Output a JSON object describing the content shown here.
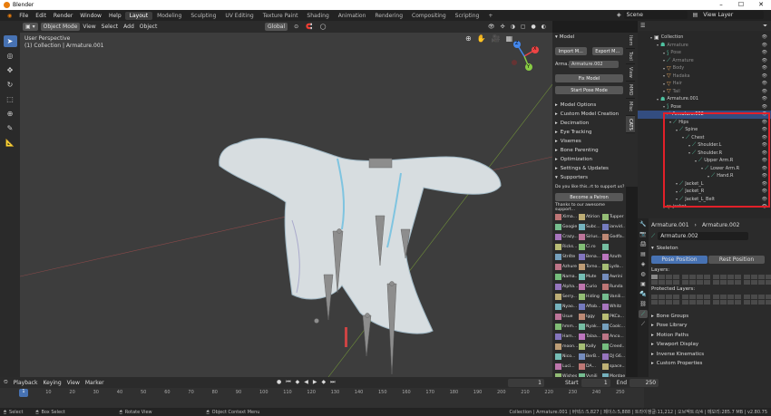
{
  "window": {
    "title": "Blender",
    "controls": [
      "–",
      "☐",
      "✕"
    ]
  },
  "menu": {
    "items": [
      "File",
      "Edit",
      "Render",
      "Window",
      "Help"
    ],
    "workspaces": [
      "Layout",
      "Modeling",
      "Sculpting",
      "UV Editing",
      "Texture Paint",
      "Shading",
      "Animation",
      "Rendering",
      "Compositing",
      "Scripting",
      "+"
    ],
    "scene": "Scene",
    "view_layer": "View Layer"
  },
  "viewport": {
    "mode": "Object Mode",
    "menus": [
      "View",
      "Select",
      "Add",
      "Object"
    ],
    "transform": "Global",
    "info_line1": "User Perspective",
    "info_line2": "(1) Collection | Armature.001",
    "gizmo": {
      "x": "X",
      "y": "Y",
      "z": "Z"
    }
  },
  "npanel": {
    "header": "Model",
    "import": "Import M...",
    "export": "Export M...",
    "armature_label": "Arma...",
    "armature_value": "Armature.002",
    "fix_model": "Fix Model",
    "start_pose": "Start Pose Mode",
    "sections": [
      "Model Options",
      "Custom Model Creation",
      "Decimation",
      "Eye Tracking",
      "Visemes",
      "Bone Parenting",
      "Optimization",
      "Settings & Updates",
      "Supporters"
    ],
    "support_q": "Do you like this..rt to support us?",
    "patron": "Become a Patron",
    "thanks": "Thanks to our awesome support...",
    "supporters": [
      "Xima...",
      "Atirion",
      "Tupper",
      "Googie",
      "Subc...",
      "ianvid...",
      "Crazy...",
      "Sirius...",
      "Godfa...",
      "Ricks...",
      "Ci.ro",
      "",
      "Str4te",
      "Bena...",
      "Azuth",
      "Azhure",
      "Torno...",
      "Lyda...",
      "Nama...",
      "Mute",
      "Awrini",
      "Alpha...",
      "Curio",
      "Runda",
      "Serry...",
      "Hiding",
      "Vanili...",
      "Nyao...",
      "Aftob...",
      "Whitz",
      "Usue",
      "Iggy",
      "PKCa...",
      "hmm...",
      "Nyak...",
      "Coolc...",
      "Ham...",
      "Talaa...",
      "Anco...",
      "moon...",
      "Kally",
      "Creed...",
      "Nico...",
      "BerB...",
      "DJ G6...",
      "Luci...",
      "DA...",
      "space...",
      "Wishes",
      "Vynili",
      "Mordae"
    ],
    "tabs": [
      "Item",
      "Tool",
      "View",
      "MMD",
      "Misc",
      "CATS"
    ]
  },
  "outliner": {
    "rows": [
      {
        "depth": 0,
        "label": "Collection",
        "kind": "collection",
        "dim": false
      },
      {
        "depth": 1,
        "label": "Armature",
        "kind": "armature",
        "dim": true
      },
      {
        "depth": 2,
        "label": "Pose",
        "kind": "pose",
        "dim": true
      },
      {
        "depth": 2,
        "label": "Armature",
        "kind": "bone",
        "dim": true
      },
      {
        "depth": 2,
        "label": "Body",
        "kind": "mesh",
        "dim": true
      },
      {
        "depth": 2,
        "label": "Hadaka",
        "kind": "mesh",
        "dim": true
      },
      {
        "depth": 2,
        "label": "Hair",
        "kind": "mesh",
        "dim": true
      },
      {
        "depth": 2,
        "label": "Tail",
        "kind": "mesh",
        "dim": true
      },
      {
        "depth": 1,
        "label": "Armature.001",
        "kind": "armature",
        "dim": false
      },
      {
        "depth": 2,
        "label": "Pose",
        "kind": "pose",
        "dim": false
      },
      {
        "depth": 2,
        "label": "Armature.002",
        "kind": "bone",
        "dim": false,
        "selected": true
      },
      {
        "depth": 3,
        "label": "Hips",
        "kind": "bone",
        "dim": false
      },
      {
        "depth": 4,
        "label": "Spine",
        "kind": "bone",
        "dim": false
      },
      {
        "depth": 5,
        "label": "Chest",
        "kind": "bone",
        "dim": false
      },
      {
        "depth": 6,
        "label": "Shoulder.L",
        "kind": "bone",
        "dim": false
      },
      {
        "depth": 6,
        "label": "Shoulder.R",
        "kind": "bone",
        "dim": false
      },
      {
        "depth": 7,
        "label": "Upper Arm.R",
        "kind": "bone",
        "dim": false
      },
      {
        "depth": 8,
        "label": "Lower Arm.R",
        "kind": "bone",
        "dim": false
      },
      {
        "depth": 9,
        "label": "Hand.R",
        "kind": "bone",
        "dim": false
      },
      {
        "depth": 4,
        "label": "Jacket_L",
        "kind": "bone",
        "dim": false
      },
      {
        "depth": 4,
        "label": "Jacket_R",
        "kind": "bone",
        "dim": false
      },
      {
        "depth": 4,
        "label": "Jacket_L_Belt",
        "kind": "bone",
        "dim": false
      },
      {
        "depth": 2,
        "label": "jacket",
        "kind": "mesh",
        "dim": false
      }
    ]
  },
  "properties": {
    "obj": "Armature.001",
    "data": "Armature.002",
    "data_field": "Armature.002",
    "skeleton": "Skeleton",
    "pose_position": "Pose Position",
    "rest_position": "Rest Position",
    "layers": "Layers:",
    "protected": "Protected Layers:",
    "sections": [
      "Bone Groups",
      "Pose Library",
      "Motion Paths",
      "Viewport Display",
      "Inverse Kinematics",
      "Custom Properties"
    ]
  },
  "timeline": {
    "menus": [
      "Playback",
      "Keying",
      "View",
      "Marker"
    ],
    "current": "1",
    "start_label": "Start",
    "start": "1",
    "end_label": "End",
    "end": "250",
    "ticks": [
      "1",
      "10",
      "20",
      "30",
      "40",
      "50",
      "60",
      "70",
      "80",
      "90",
      "100",
      "110",
      "120",
      "130",
      "140",
      "150",
      "160",
      "170",
      "180",
      "190",
      "200",
      "210",
      "220",
      "230",
      "240",
      "250"
    ]
  },
  "status": {
    "select": "Select",
    "box_select": "Box Select",
    "rotate": "Rotate View",
    "context": "Object Context Menu",
    "stats": "Collection | Armature.001 | 버텍스:5,827 | 페이스:5,888 | 트라이앵글:11,212 | 오브젝트:0/4 | 메모리:285.7 MB | v2.80.75"
  }
}
